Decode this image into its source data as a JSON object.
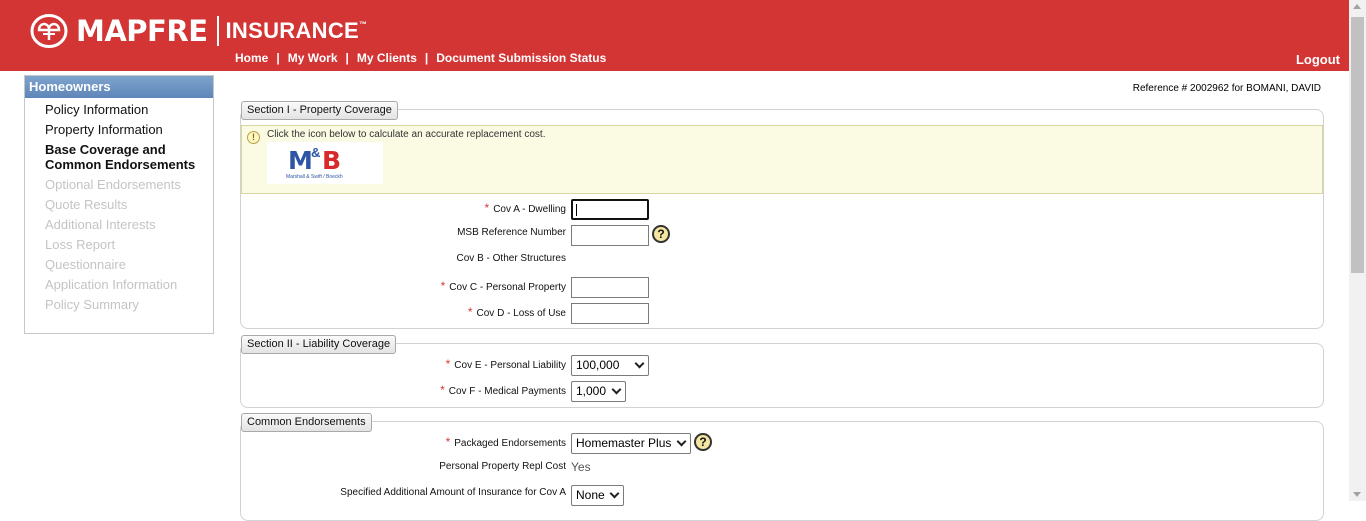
{
  "brand": {
    "name": "MAPFRE",
    "product": "INSURANCE",
    "tm": "™"
  },
  "nav": {
    "items": [
      "Home",
      "My Work",
      "My Clients",
      "Document Submission Status"
    ],
    "separator": "|",
    "logout": "Logout"
  },
  "sidebar": {
    "title": "Homeowners",
    "items": [
      {
        "label": "Policy Information",
        "state": "enabled"
      },
      {
        "label": "Property Information",
        "state": "enabled"
      },
      {
        "label": "Base Coverage and Common Endorsements",
        "state": "active"
      },
      {
        "label": "Optional Endorsements",
        "state": "disabled"
      },
      {
        "label": "Quote Results",
        "state": "disabled"
      },
      {
        "label": "Additional Interests",
        "state": "disabled"
      },
      {
        "label": "Loss Report",
        "state": "disabled"
      },
      {
        "label": "Questionnaire",
        "state": "disabled"
      },
      {
        "label": "Application Information",
        "state": "disabled"
      },
      {
        "label": "Policy Summary",
        "state": "disabled"
      }
    ]
  },
  "reference": "Reference # 2002962 for BOMANI, DAVID",
  "section1": {
    "legend": "Section I - Property Coverage",
    "info_text": "Click the icon below to calculate an accurate replacement cost.",
    "msb": {
      "m": "M",
      "amp": "&",
      "s": "S",
      "b": "B",
      "caption": "Marshall & Swift / Boeckh"
    },
    "fields": {
      "cov_a": {
        "label": "Cov A - Dwelling",
        "value": ""
      },
      "msb_ref": {
        "label": "MSB Reference Number",
        "value": ""
      },
      "cov_b": {
        "label": "Cov B - Other Structures"
      },
      "cov_c": {
        "label": "Cov C - Personal Property",
        "value": ""
      },
      "cov_d": {
        "label": "Cov D - Loss of Use",
        "value": ""
      }
    }
  },
  "section2": {
    "legend": "Section II - Liability Coverage",
    "cov_e": {
      "label": "Cov E - Personal Liability",
      "value": "100,000"
    },
    "cov_f": {
      "label": "Cov F - Medical Payments",
      "value": "1,000"
    }
  },
  "section3": {
    "legend": "Common Endorsements",
    "packaged": {
      "label": "Packaged Endorsements",
      "value": "Homemaster Plus"
    },
    "repl_cost": {
      "label": "Personal Property Repl Cost",
      "value": "Yes"
    },
    "specified": {
      "label": "Specified Additional Amount of Insurance for Cov A",
      "value": "None"
    }
  },
  "required_mark": "*",
  "help_glyph": "?",
  "colors": {
    "header": "#d33434",
    "required": "#d63a3a",
    "sidebar_title": "#5d86b9"
  }
}
